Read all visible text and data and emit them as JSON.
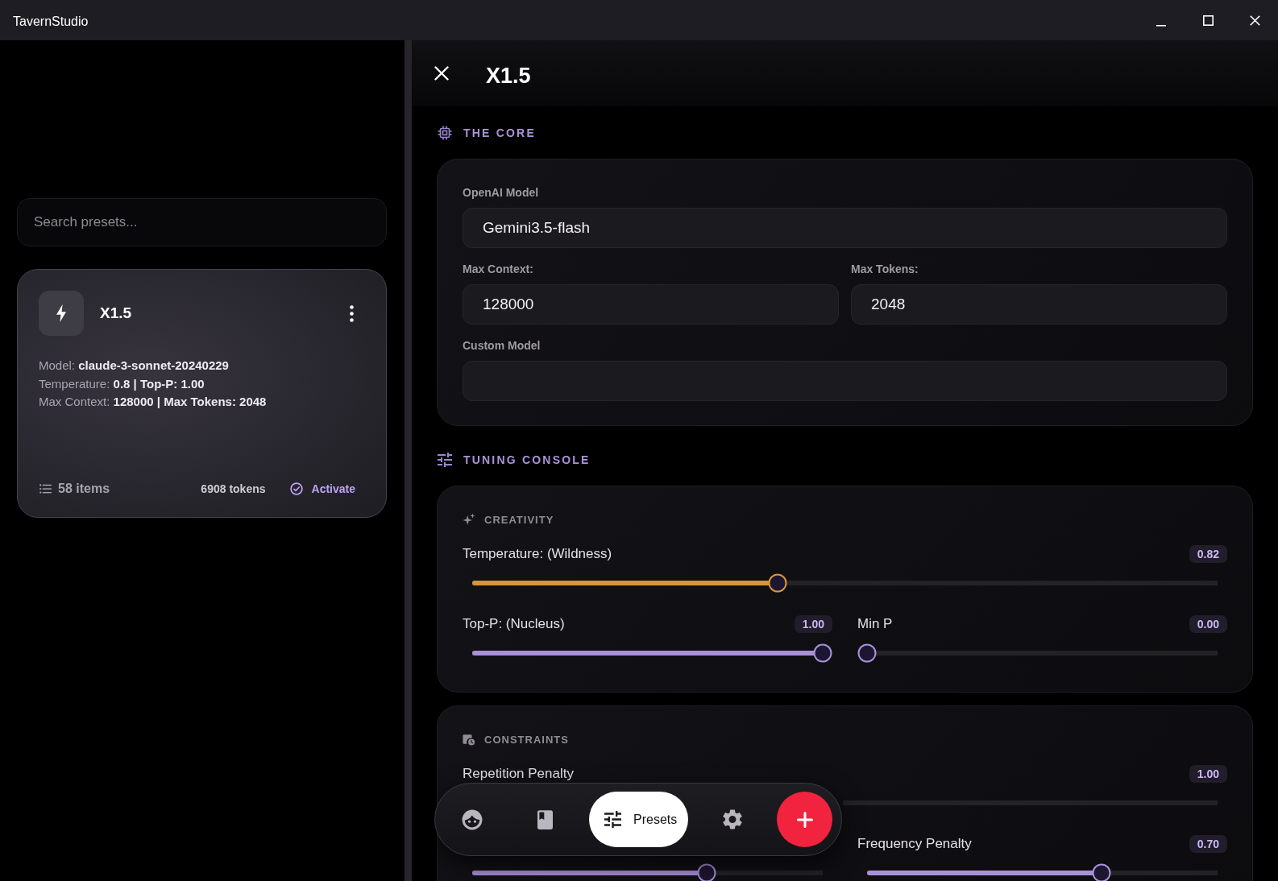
{
  "window": {
    "title": "TavernStudio"
  },
  "sidebar": {
    "search": {
      "placeholder": "Search presets..."
    },
    "presets": [
      {
        "title": "X1.5",
        "details": [
          "Model: **claude-3-sonnet-20240229**",
          "Temperature: **0.8 | Top-P: 1.00**",
          "Max Context: **128000 | Max Tokens: 2048**"
        ],
        "item_count": "58 items",
        "tokens": "6908 tokens",
        "action": "Activate"
      }
    ]
  },
  "editor": {
    "title": "X1.5",
    "sections": [
      {
        "kind": "form",
        "title": "THE CORE",
        "rows": [
          {
            "fields": [
              {
                "label": "OpenAI Model",
                "value": "Gemini3.5-flash"
              }
            ]
          },
          {
            "fields": [
              {
                "label": "Max Context:",
                "value": "128000"
              },
              {
                "label": "Max Tokens:",
                "value": "2048"
              }
            ]
          },
          {
            "fields": [
              {
                "label": "Custom Model"
              }
            ]
          }
        ]
      },
      {
        "kind": "sliders",
        "title": "TUNING CONSOLE",
        "groups": [
          {
            "title": "CREATIVITY",
            "rows": [
              {
                "sliders": [
                  {
                    "label": "Temperature: (Wildness)",
                    "reading": "0.82",
                    "level": 0.41,
                    "color": "#d6963b"
                  }
                ]
              },
              {
                "sliders": [
                  {
                    "label": "Top-P: (Nucleus)",
                    "reading": "1.00",
                    "level": 1,
                    "color": "#a991d9"
                  },
                  {
                    "label": "Min P",
                    "reading": "0.00",
                    "level": 0,
                    "color": "#a991d9"
                  }
                ]
              }
            ]
          },
          {
            "title": "CONSTRAINTS",
            "rows": [
              {
                "sliders": [
                  {
                    "label": "Repetition Penalty",
                    "reading": "1.00"
                  }
                ]
              },
              {
                "sliders": [
                  {
                    "level": 0.67,
                    "color": "#a991d9"
                  },
                  {
                    "label": "Frequency Penalty",
                    "reading": "0.70",
                    "level": 0.67,
                    "color": "#a991d9"
                  }
                ]
              }
            ]
          }
        ]
      }
    ]
  },
  "bottom_nav": {
    "items": [
      {
        "selected": false
      },
      {
        "selected": false
      },
      {
        "label": "Presets",
        "selected": true
      },
      {
        "selected": false
      }
    ]
  }
}
